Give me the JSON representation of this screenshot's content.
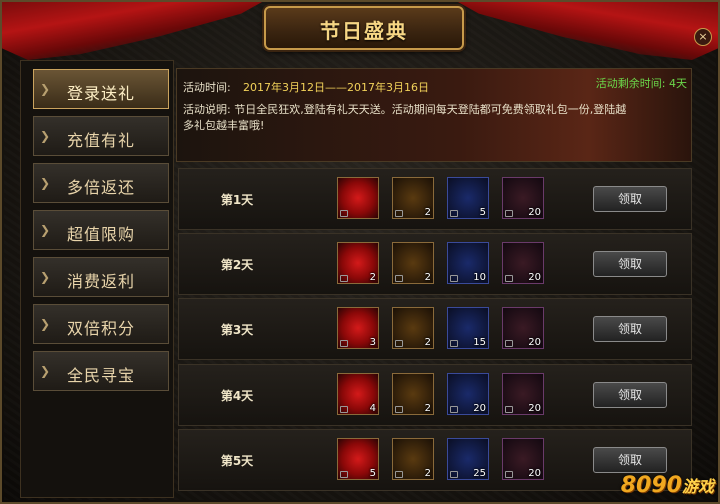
{
  "window": {
    "title": "节日盛典",
    "close_label": "×"
  },
  "sidebar": {
    "items": [
      {
        "label": "登录送礼",
        "active": true
      },
      {
        "label": "充值有礼",
        "active": false
      },
      {
        "label": "多倍返还",
        "active": false
      },
      {
        "label": "超值限购",
        "active": false
      },
      {
        "label": "消费返利",
        "active": false
      },
      {
        "label": "双倍积分",
        "active": false
      },
      {
        "label": "全民寻宝",
        "active": false
      }
    ]
  },
  "info": {
    "time_label": "活动时间:",
    "time_value": "2017年3月12日——2017年3月16日",
    "remaining": "活动剩余时间: 4天",
    "desc_line1": "活动说明: 节日全民狂欢,登陆有礼天天送。活动期间每天登陆都可免费领取礼包一份,登陆越",
    "desc_line2": "多礼包越丰富哦!"
  },
  "rows": [
    {
      "day": "第1天",
      "items": [
        {
          "icon": "treasure-seal-icon",
          "count": ""
        },
        {
          "icon": "gold-bars-icon",
          "count": "2"
        },
        {
          "icon": "blue-orb-icon",
          "count": "5"
        },
        {
          "icon": "fire-orb-icon",
          "count": "20"
        }
      ],
      "button": "领取"
    },
    {
      "day": "第2天",
      "items": [
        {
          "icon": "treasure-seal-icon",
          "count": "2"
        },
        {
          "icon": "gold-bars-icon",
          "count": "2"
        },
        {
          "icon": "blue-orb-icon",
          "count": "10"
        },
        {
          "icon": "fire-orb-icon",
          "count": "20"
        }
      ],
      "button": "领取"
    },
    {
      "day": "第3天",
      "items": [
        {
          "icon": "treasure-seal-icon",
          "count": "3"
        },
        {
          "icon": "gold-bars-icon",
          "count": "2"
        },
        {
          "icon": "blue-orb-icon",
          "count": "15"
        },
        {
          "icon": "fire-orb-icon",
          "count": "20"
        }
      ],
      "button": "领取"
    },
    {
      "day": "第4天",
      "items": [
        {
          "icon": "treasure-seal-icon",
          "count": "4"
        },
        {
          "icon": "gold-bars-icon",
          "count": "2"
        },
        {
          "icon": "blue-orb-icon",
          "count": "20"
        },
        {
          "icon": "fire-orb-icon",
          "count": "20"
        }
      ],
      "button": "领取"
    },
    {
      "day": "第5天",
      "items": [
        {
          "icon": "treasure-seal-icon",
          "count": "5"
        },
        {
          "icon": "gold-bars-icon",
          "count": "2"
        },
        {
          "icon": "blue-orb-icon",
          "count": "25"
        },
        {
          "icon": "fire-orb-icon",
          "count": "20"
        }
      ],
      "button": "领取"
    }
  ],
  "watermark": {
    "brand": "8090",
    "suffix": "游戏"
  },
  "colors": {
    "accent_gold": "#f6d684",
    "green_text": "#6bd84a",
    "yellow_text": "#f2d25a",
    "drape_red": "#b51414"
  }
}
